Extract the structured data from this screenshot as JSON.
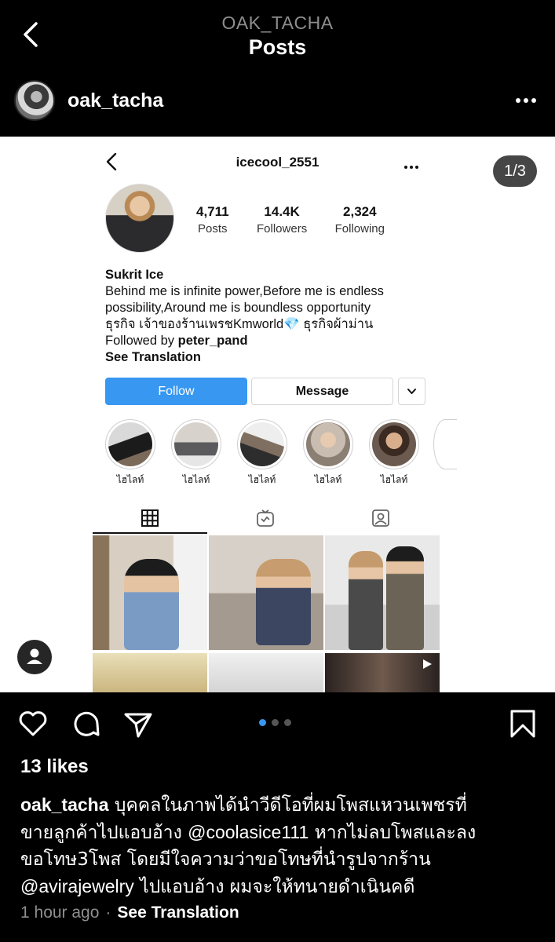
{
  "header": {
    "username": "OAK_TACHA",
    "title": "Posts"
  },
  "post": {
    "username": "oak_tacha",
    "counter": "1/3"
  },
  "embedded_profile": {
    "username": "icecool_2551",
    "stats": [
      {
        "value": "4,711",
        "label": "Posts"
      },
      {
        "value": "14.4K",
        "label": "Followers"
      },
      {
        "value": "2,324",
        "label": "Following"
      }
    ],
    "name": "Sukrit Ice",
    "bio_line1": "Behind me is infinite power,Before me is endless",
    "bio_line2": "possibility,Around me is boundless opportunity",
    "bio_line3_a": "ธุรกิจ เจ้าของร้านเพรชKmworld",
    "bio_line3_gem": "💎",
    "bio_line3_b": " ธุรกิจผ้าม่าน",
    "followed_by_prefix": "Followed by ",
    "followed_by_user": "peter_pand",
    "see_translation": "See Translation",
    "follow_label": "Follow",
    "message_label": "Message",
    "highlights": [
      "ไฮไลท์",
      "ไฮไลท์",
      "ไฮไลท์",
      "ไฮไลท์",
      "ไฮไลท์"
    ]
  },
  "engagement": {
    "likes": "13 likes",
    "caption_user": "oak_tacha",
    "caption_line1": " บุคคลในภาพได้นำวีดีโอที่ผมโพสแหวนเพชรที่",
    "caption_line2_a": "ขายลูกค้าไปแอบอ้าง ",
    "caption_mention1": "@coolasice111",
    "caption_line2_b": " หากไม่ลบโพสและลง",
    "caption_line3": "ขอโทษ3โพส โดยมีใจความว่าขอโทษที่นำรูปจากร้าน",
    "caption_mention2": "@avirajewelry",
    "caption_line4_b": " ไปแอบอ้าง ผมจะให้ทนายดำเนินคดี",
    "time": "1 hour ago",
    "separator": "·",
    "see_translation": "See Translation"
  },
  "carousel": {
    "total": 3,
    "active_index": 0
  },
  "colors": {
    "background": "#000000",
    "accent": "#3897f0",
    "muted": "#8e8e8e"
  },
  "icons": [
    "back-icon",
    "more-icon",
    "heart-icon",
    "comment-icon",
    "share-icon",
    "bookmark-icon",
    "grid-icon",
    "igtv-icon",
    "tagged-icon",
    "chevron-down-icon",
    "user-icon"
  ]
}
